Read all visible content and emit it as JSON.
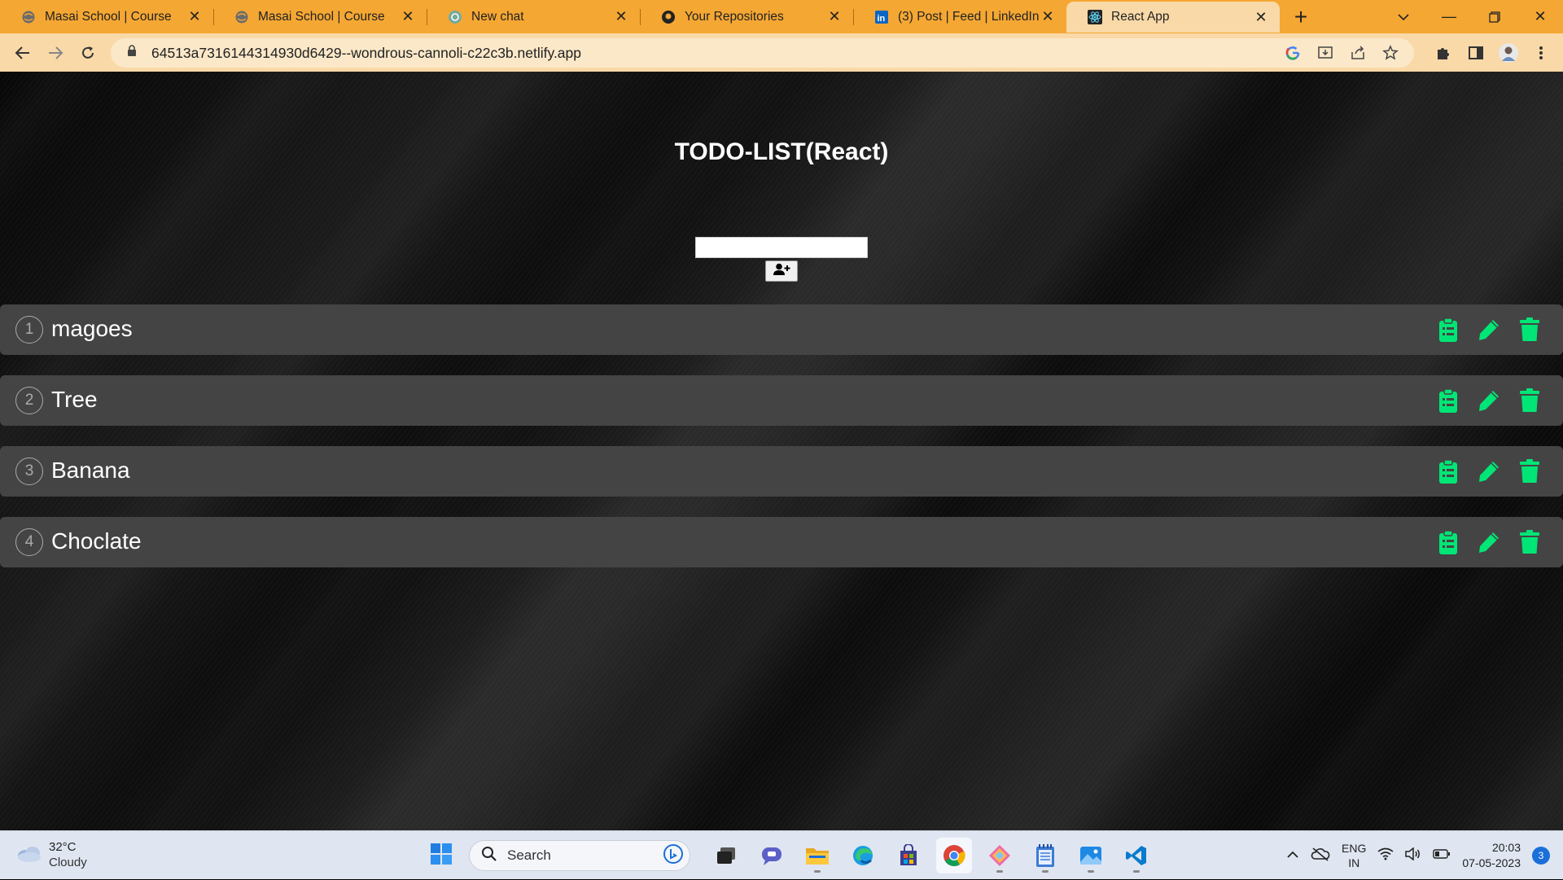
{
  "browser": {
    "tabs": [
      {
        "title": "Masai School | Course",
        "icon": "globe-icon"
      },
      {
        "title": "Masai School | Course",
        "icon": "globe-icon"
      },
      {
        "title": "New chat",
        "icon": "chatgpt-icon"
      },
      {
        "title": "Your Repositories",
        "icon": "github-icon"
      },
      {
        "title": "(3) Post | Feed | LinkedIn",
        "icon": "linkedin-icon"
      },
      {
        "title": "React App",
        "icon": "react-icon",
        "active": true
      }
    ],
    "url": "64513a7316144314930d6429--wondrous-cannoli-c22c3b.netlify.app",
    "accent_color": "#f5a733"
  },
  "app": {
    "title": "TODO-LIST(React)",
    "input_value": "",
    "add_button_icon": "add-user-icon",
    "action_color": "#00e676",
    "todos": [
      {
        "number": "1",
        "text": "magoes"
      },
      {
        "number": "2",
        "text": "Tree"
      },
      {
        "number": "3",
        "text": "Banana"
      },
      {
        "number": "4",
        "text": "Choclate"
      }
    ]
  },
  "taskbar": {
    "weather_temp": "32°C",
    "weather_desc": "Cloudy",
    "search_label": "Search",
    "lang_top": "ENG",
    "lang_bottom": "IN",
    "time": "20:03",
    "date": "07-05-2023",
    "notification_count": "3"
  }
}
